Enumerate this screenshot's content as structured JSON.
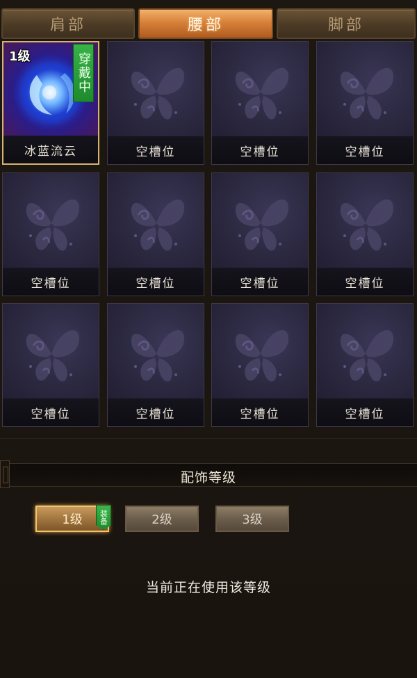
{
  "tabs": [
    {
      "label": "肩部",
      "active": false
    },
    {
      "label": "腰部",
      "active": true
    },
    {
      "label": "脚部",
      "active": false
    }
  ],
  "slots": [
    {
      "name": "冰蓝流云",
      "level": "1级",
      "status": "穿戴中",
      "equipped": true
    },
    {
      "name": "空槽位",
      "equipped": false
    },
    {
      "name": "空槽位",
      "equipped": false
    },
    {
      "name": "空槽位",
      "equipped": false
    },
    {
      "name": "空槽位",
      "equipped": false
    },
    {
      "name": "空槽位",
      "equipped": false
    },
    {
      "name": "空槽位",
      "equipped": false
    },
    {
      "name": "空槽位",
      "equipped": false
    },
    {
      "name": "空槽位",
      "equipped": false
    },
    {
      "name": "空槽位",
      "equipped": false
    },
    {
      "name": "空槽位",
      "equipped": false
    },
    {
      "name": "空槽位",
      "equipped": false
    }
  ],
  "section": {
    "title": "配饰等级"
  },
  "levels": [
    {
      "label": "1级",
      "selected": true,
      "tag": "装备"
    },
    {
      "label": "2级",
      "selected": false
    },
    {
      "label": "3级",
      "selected": false
    }
  ],
  "status_text": "当前正在使用该等级",
  "colors": {
    "active_tab": "#d7813a",
    "equipped_tag": "#1f8a2e",
    "slot_bg": "#2b2840",
    "selected_border": "#f2c36a"
  },
  "icons": {
    "empty_slot": "butterfly-icon",
    "equipped_item": "blue-orb-icon"
  }
}
